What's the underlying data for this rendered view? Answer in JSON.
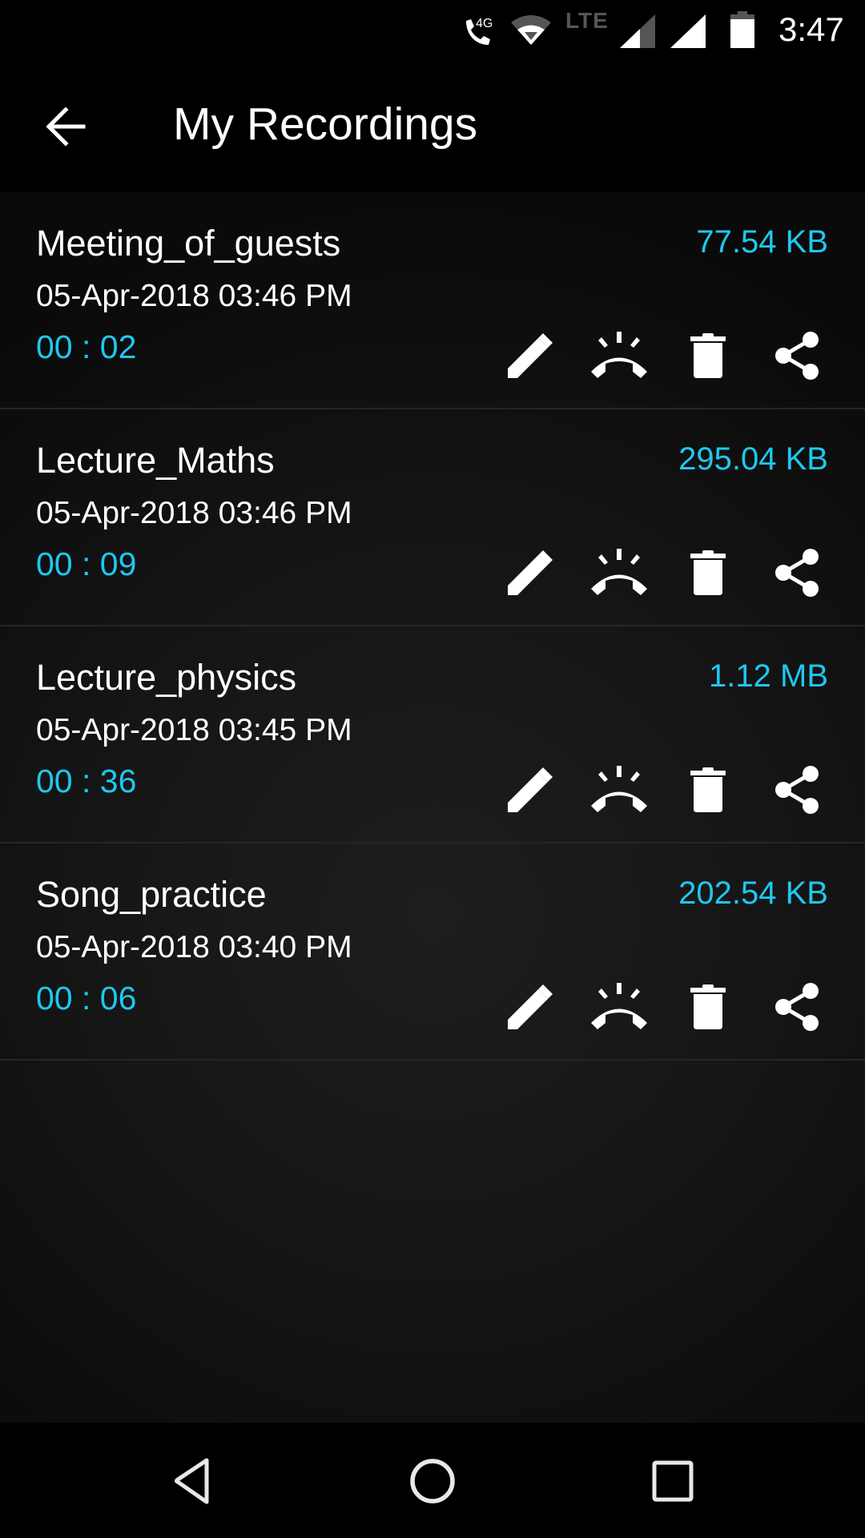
{
  "status_bar": {
    "network_label": "4G",
    "lte_label": "LTE",
    "time": "3:47",
    "icons": [
      "wifi-calling-icon",
      "wifi-icon",
      "cell-signal-icon",
      "cell-signal-icon",
      "battery-icon"
    ]
  },
  "toolbar": {
    "title": "My Recordings",
    "back_icon": "arrow-back-icon"
  },
  "theme": {
    "accent": "#1ec8ef",
    "text": "#ffffff",
    "divider": "#262626"
  },
  "recordings": [
    {
      "name": "Meeting_of_guests",
      "date": "05-Apr-2018 03:46 PM",
      "duration": "00 : 02",
      "size": "77.54 KB"
    },
    {
      "name": "Lecture_Maths",
      "date": "05-Apr-2018 03:46 PM",
      "duration": "00 : 09",
      "size": "295.04 KB"
    },
    {
      "name": "Lecture_physics",
      "date": "05-Apr-2018 03:45 PM",
      "duration": "00 : 36",
      "size": "1.12 MB"
    },
    {
      "name": "Song_practice",
      "date": "05-Apr-2018 03:40 PM",
      "duration": "00 : 06",
      "size": "202.54 KB"
    }
  ],
  "row_actions": [
    "edit-icon",
    "ringtone-icon",
    "delete-icon",
    "share-icon"
  ],
  "nav_bar": {
    "icons": [
      "nav-back-icon",
      "nav-home-icon",
      "nav-recents-icon"
    ]
  }
}
